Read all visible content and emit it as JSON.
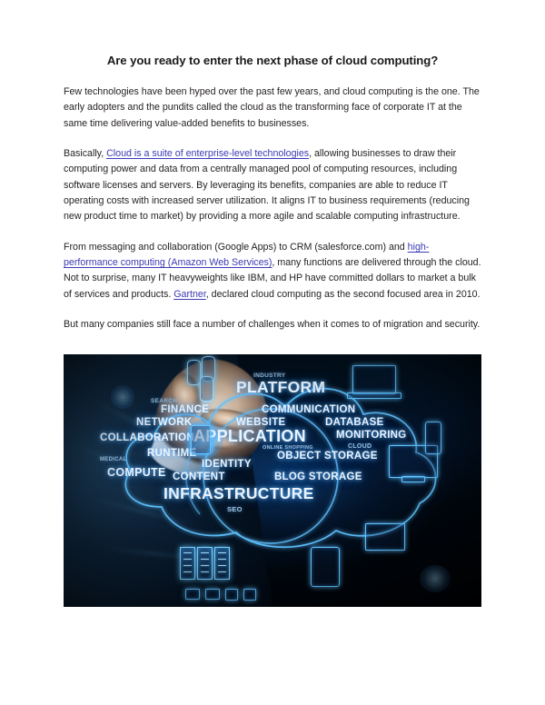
{
  "document": {
    "title": "Are you ready to enter the next phase of cloud computing?",
    "paragraphs": {
      "p1": "Few technologies have been hyped over the past few years, and cloud computing is the one. The early adopters and the pundits called the cloud as the transforming face of corporate IT at the same time delivering value-added benefits to businesses.",
      "p2_pre": "Basically, ",
      "p2_link": "Cloud is a suite of enterprise-level technologies",
      "p2_post": ", allowing businesses to draw their computing power and data from a centrally managed pool of computing resources, including software licenses and servers. By leveraging its benefits, companies are able to reduce IT operating costs with increased server utilization. It aligns IT to business requirements (reducing new product time to market) by providing a more agile and scalable computing infrastructure.",
      "p3_pre": "From messaging and collaboration (Google Apps) to CRM (salesforce.com) and ",
      "p3_link1": "high-performance computing (Amazon Web Services)",
      "p3_mid": ", many functions are delivered through the cloud. Not to surprise, many IT heavyweights like IBM, and HP have committed dollars to market a bulk of services and products. ",
      "p3_link2": "Gartner",
      "p3_post": ", declared cloud computing as the second focused area in 2010.",
      "p4": "But many companies still face a number of challenges when it comes to of migration and security."
    }
  },
  "figure": {
    "alt": "cloud computing word cloud illustration",
    "words": {
      "industry": "INDUSTRY",
      "platform": "PLATFORM",
      "search": "SEARCH",
      "finance": "FINANCE",
      "communication": "COMMUNICATION",
      "network": "NETWORK",
      "website": "WEBSITE",
      "database": "DATABASE",
      "collaboration": "COLLABORATION",
      "application": "APPLICATION",
      "monitoring": "MONITORING",
      "cloud": "CLOUD",
      "online_shopping": "ONLINE SHOPPING",
      "runtime": "RUNTIME",
      "object_storage": "OBJECT STORAGE",
      "medical": "MEDICAL",
      "identity": "IDENTITY",
      "compute": "COMPUTE",
      "content": "CONTENT",
      "blog_storage": "BLOG STORAGE",
      "infrastructure": "INFRASTRUCTURE",
      "seo": "SEO"
    },
    "colors": {
      "glow": "#63c4ff",
      "text": "#eaf4ff",
      "background": "#000206"
    }
  }
}
